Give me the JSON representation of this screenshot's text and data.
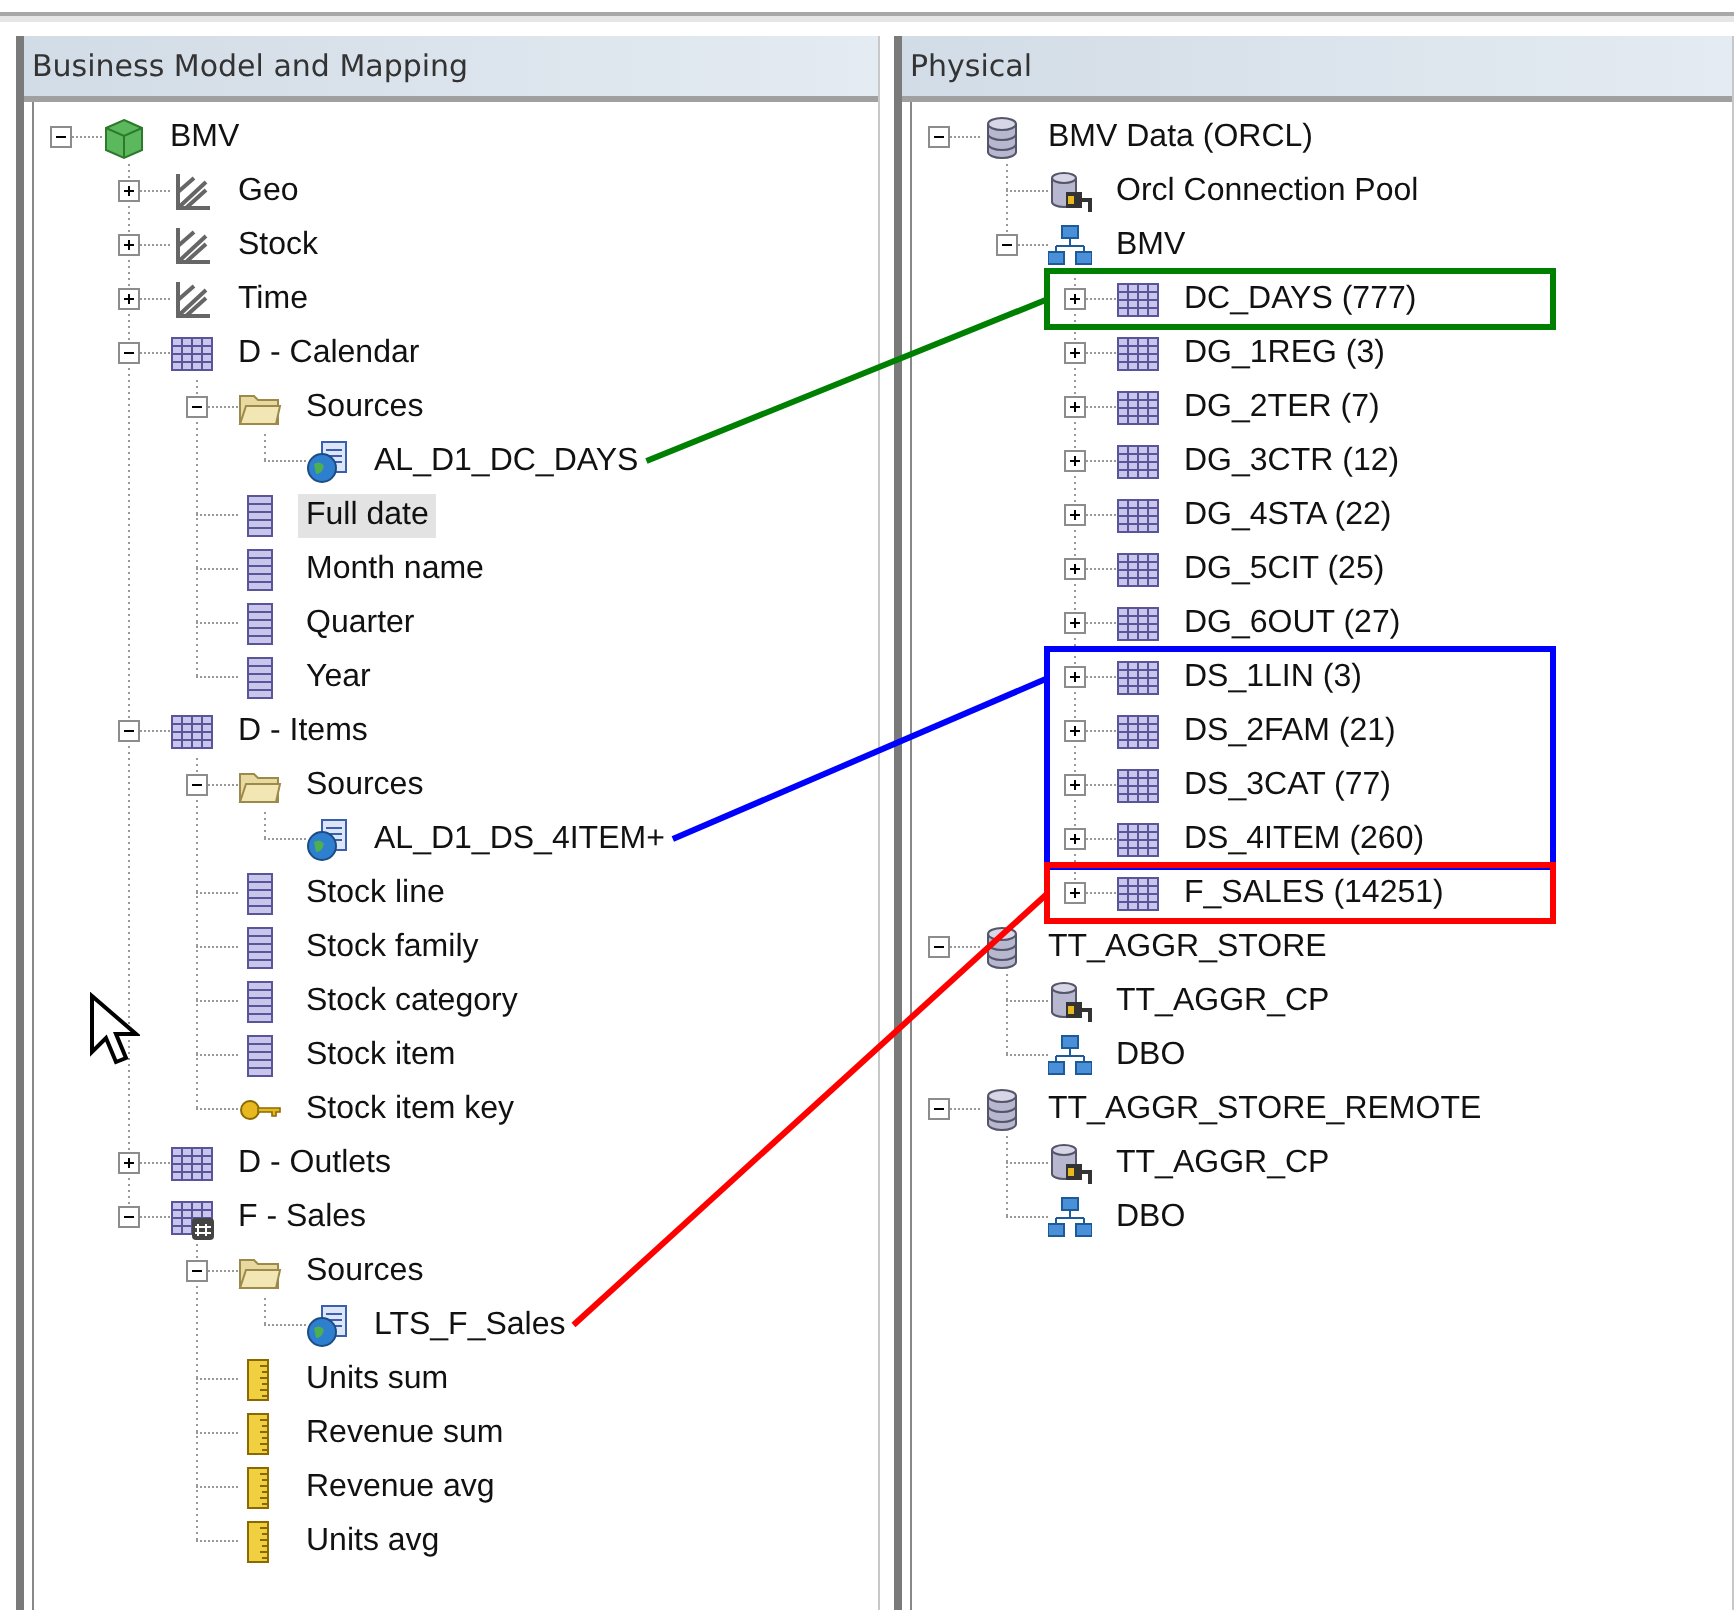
{
  "panels": [
    {
      "title": "Business Model and Mapping",
      "cursor": true,
      "tree": [
        {
          "label": "BMV",
          "kind": "cube",
          "selected": false,
          "expanded": true,
          "children": [
            {
              "label": "Geo",
              "kind": "hierarchy",
              "selected": false,
              "expanded": false
            },
            {
              "label": "Stock",
              "kind": "hierarchy",
              "selected": false,
              "expanded": false
            },
            {
              "label": "Time",
              "kind": "hierarchy",
              "selected": false,
              "expanded": false
            },
            {
              "label": "D - Calendar",
              "kind": "table",
              "selected": false,
              "expanded": true,
              "children": [
                {
                  "label": "Sources",
                  "kind": "folder",
                  "selected": false,
                  "expanded": true,
                  "children": [
                    {
                      "label": "AL_D1_DC_DAYS",
                      "kind": "source",
                      "selected": false,
                      "color": "#008000"
                    }
                  ]
                },
                {
                  "label": "Full date",
                  "kind": "column",
                  "selected": true
                },
                {
                  "label": "Month name",
                  "kind": "column",
                  "selected": false
                },
                {
                  "label": "Quarter",
                  "kind": "column",
                  "selected": false
                },
                {
                  "label": "Year",
                  "kind": "column",
                  "selected": false
                }
              ]
            },
            {
              "label": "D - Items",
              "kind": "table",
              "selected": false,
              "expanded": true,
              "children": [
                {
                  "label": "Sources",
                  "kind": "folder",
                  "selected": false,
                  "expanded": true,
                  "children": [
                    {
                      "label": "AL_D1_DS_4ITEM+",
                      "kind": "source",
                      "selected": false,
                      "color": "#0000ff"
                    }
                  ]
                },
                {
                  "label": "Stock line",
                  "kind": "column",
                  "selected": false
                },
                {
                  "label": "Stock family",
                  "kind": "column",
                  "selected": false
                },
                {
                  "label": "Stock category",
                  "kind": "column",
                  "selected": false
                },
                {
                  "label": "Stock item",
                  "kind": "column",
                  "selected": false
                },
                {
                  "label": "Stock item key",
                  "kind": "key",
                  "selected": false
                }
              ]
            },
            {
              "label": "D - Outlets",
              "kind": "table",
              "selected": false,
              "expanded": false
            },
            {
              "label": "F - Sales",
              "kind": "fact",
              "selected": false,
              "expanded": true,
              "children": [
                {
                  "label": "Sources",
                  "kind": "folder",
                  "selected": false,
                  "expanded": true,
                  "children": [
                    {
                      "label": "LTS_F_Sales",
                      "kind": "source",
                      "selected": false,
                      "color": "#ff0000"
                    }
                  ]
                },
                {
                  "label": "Units sum",
                  "kind": "measure",
                  "selected": false
                },
                {
                  "label": "Revenue sum",
                  "kind": "measure",
                  "selected": false
                },
                {
                  "label": "Revenue avg",
                  "kind": "measure",
                  "selected": false
                },
                {
                  "label": "Units avg",
                  "kind": "measure",
                  "selected": false
                }
              ]
            }
          ]
        }
      ]
    },
    {
      "title": "Physical",
      "tree": [
        {
          "label": "BMV Data (ORCL)",
          "kind": "database",
          "selected": false,
          "expanded": true,
          "children": [
            {
              "label": "Orcl Connection Pool",
              "kind": "pool",
              "selected": false
            },
            {
              "label": "BMV",
              "kind": "schema",
              "selected": false,
              "expanded": true,
              "children": [
                {
                  "label": "DC_DAYS (777)",
                  "kind": "table",
                  "selected": false,
                  "expanded": false,
                  "color": "#008000"
                },
                {
                  "label": "DG_1REG (3)",
                  "kind": "table",
                  "selected": false,
                  "expanded": false
                },
                {
                  "label": "DG_2TER (7)",
                  "kind": "table",
                  "selected": false,
                  "expanded": false
                },
                {
                  "label": "DG_3CTR (12)",
                  "kind": "table",
                  "selected": false,
                  "expanded": false
                },
                {
                  "label": "DG_4STA (22)",
                  "kind": "table",
                  "selected": false,
                  "expanded": false
                },
                {
                  "label": "DG_5CIT (25)",
                  "kind": "table",
                  "selected": false,
                  "expanded": false
                },
                {
                  "label": "DG_6OUT (27)",
                  "kind": "table",
                  "selected": false,
                  "expanded": false
                },
                {
                  "label": "DS_1LIN (3)",
                  "kind": "table",
                  "selected": false,
                  "expanded": false,
                  "color": "#0000ff"
                },
                {
                  "label": "DS_2FAM (21)",
                  "kind": "table",
                  "selected": false,
                  "expanded": false,
                  "color": "#0000ff"
                },
                {
                  "label": "DS_3CAT (77)",
                  "kind": "table",
                  "selected": false,
                  "expanded": false,
                  "color": "#0000ff"
                },
                {
                  "label": "DS_4ITEM (260)",
                  "kind": "table",
                  "selected": false,
                  "expanded": false,
                  "color": "#0000ff"
                },
                {
                  "label": "F_SALES (14251)",
                  "kind": "table",
                  "selected": false,
                  "expanded": false,
                  "color": "#ff0000"
                }
              ]
            }
          ]
        },
        {
          "label": "TT_AGGR_STORE",
          "kind": "database",
          "selected": false,
          "expanded": true,
          "children": [
            {
              "label": "TT_AGGR_CP",
              "kind": "pool",
              "selected": false
            },
            {
              "label": "DBO",
              "kind": "schema",
              "selected": false
            }
          ]
        },
        {
          "label": "TT_AGGR_STORE_REMOTE",
          "kind": "database",
          "selected": false,
          "expanded": true,
          "children": [
            {
              "label": "TT_AGGR_CP",
              "kind": "pool",
              "selected": false
            },
            {
              "label": "DBO",
              "kind": "schema",
              "selected": false
            }
          ]
        }
      ]
    }
  ]
}
